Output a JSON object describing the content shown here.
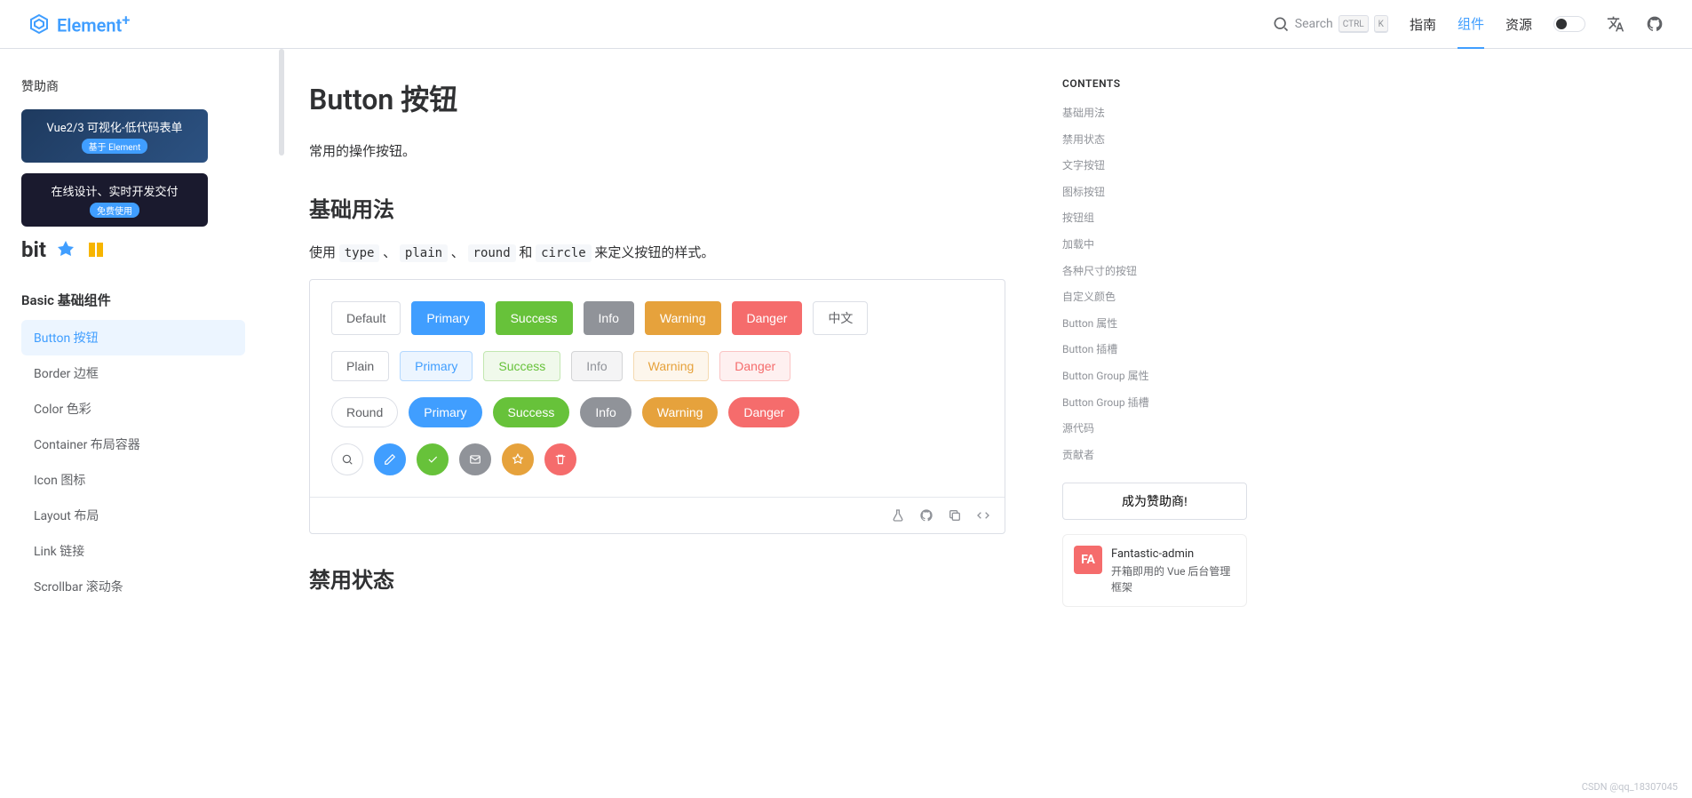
{
  "header": {
    "logo": "Element",
    "logo_sup": "+",
    "search_placeholder": "Search",
    "kbd1": "CTRL",
    "kbd2": "K",
    "nav": [
      "指南",
      "组件",
      "资源"
    ]
  },
  "sidebar": {
    "sponsor_title": "赞助商",
    "sponsors": [
      {
        "title": "Vue2/3 可视化-低代码表单",
        "sub": "基于 Element"
      },
      {
        "title": "在线设计、实时开发交付",
        "sub": "免费使用"
      }
    ],
    "bit": "bit",
    "category": "Basic 基础组件",
    "items": [
      {
        "label": "Button 按钮",
        "active": true
      },
      {
        "label": "Border 边框"
      },
      {
        "label": "Color 色彩"
      },
      {
        "label": "Container 布局容器"
      },
      {
        "label": "Icon 图标"
      },
      {
        "label": "Layout 布局"
      },
      {
        "label": "Link 链接"
      },
      {
        "label": "Scrollbar 滚动条"
      }
    ]
  },
  "main": {
    "title": "Button 按钮",
    "desc": "常用的操作按钮。",
    "section1_title": "基础用法",
    "section1_pre": "使用 ",
    "section1_code1": "type",
    "section1_sep1": " 、 ",
    "section1_code2": "plain",
    "section1_sep2": " 、 ",
    "section1_code3": "round",
    "section1_sep3": " 和 ",
    "section1_code4": "circle",
    "section1_post": " 来定义按钮的样式。",
    "buttons": {
      "default": "Default",
      "primary": "Primary",
      "success": "Success",
      "info": "Info",
      "warning": "Warning",
      "danger": "Danger",
      "cn": "中文",
      "plain": "Plain",
      "round": "Round"
    },
    "section2_title": "禁用状态"
  },
  "toc": {
    "title": "CONTENTS",
    "items": [
      "基础用法",
      "禁用状态",
      "文字按钮",
      "图标按钮",
      "按钮组",
      "加载中",
      "各种尺寸的按钮",
      "自定义颜色",
      "Button 属性",
      "Button 插槽",
      "Button Group 属性",
      "Button Group 插槽",
      "源代码",
      "贡献者"
    ],
    "sponsor_btn": "成为赞助商!",
    "fa_title": "Fantastic-admin",
    "fa_desc": "开箱即用的 Vue 后台管理框架",
    "fa_icon": "FA"
  },
  "watermark": "CSDN @qq_18307045"
}
